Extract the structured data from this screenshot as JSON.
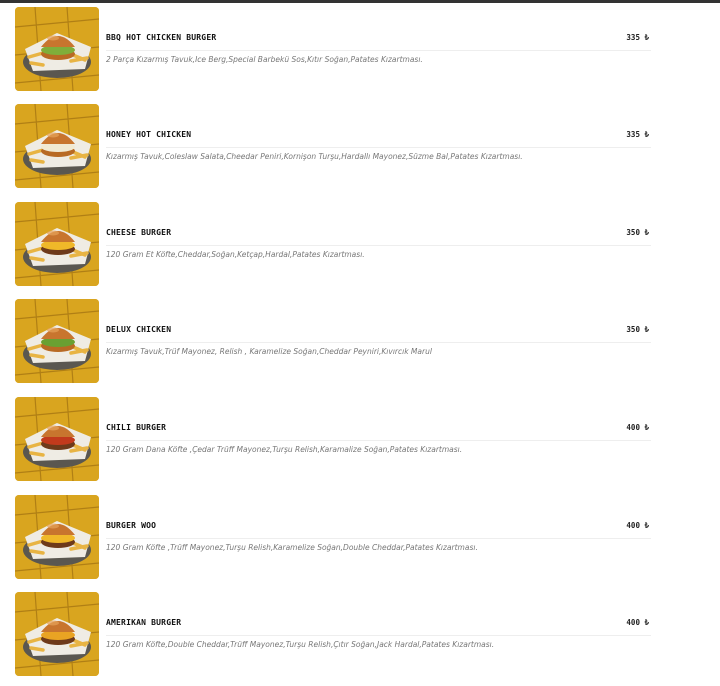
{
  "menu": {
    "currency": "₺",
    "items": [
      {
        "name": "BBQ HOT CHICKEN BURGER",
        "price": "335 ₺",
        "description": "2 Parça Kızarmış Tavuk,Ice Berg,Special Barbekü Sos,Kıtır Soğan,Patates Kızartması."
      },
      {
        "name": "HONEY HOT CHICKEN",
        "price": "335 ₺",
        "description": "Kızarmış Tavuk,Coleslaw Salata,Cheedar Peniri,Kornişon Turşu,Hardallı Mayonez,Süzme Bal,Patates Kızartması."
      },
      {
        "name": "CHEESE BURGER",
        "price": "350 ₺",
        "description": "120 Gram Et Köfte,Cheddar,Soğan,Ketçap,Hardal,Patates Kızartması."
      },
      {
        "name": "DELUX CHICKEN",
        "price": "350 ₺",
        "description": "Kızarmış Tavuk,Trüf Mayonez, Relish , Karamelize Soğan,Cheddar Peyniri,Kıvırcık Marul"
      },
      {
        "name": "CHILI BURGER",
        "price": "400 ₺",
        "description": "120 Gram Dana Köfte ,Çedar Trüff Mayonez,Turşu Relish,Karamalize Soğan,Patates Kızartması."
      },
      {
        "name": "BURGER WOO",
        "price": "400 ₺",
        "description": "120 Gram Köfte ,Trüff Mayonez,Turşu Relish,Karamelize Soğan,Double Cheddar,Patates Kızartması."
      },
      {
        "name": "AMERIKAN BURGER",
        "price": "400 ₺",
        "description": "120 Gram Köfte,Double Cheddar,Trüff Mayonez,Turşu Relish,Çıtır Soğan,Jack Hardal,Patates Kızartması."
      }
    ]
  },
  "colors": {
    "table_yellow": "#d9a51f",
    "tray": "#e8e4dc",
    "bun": "#c8752e",
    "fries": "#e8b443"
  },
  "icons": {
    "item_image": "burger-photo-icon"
  }
}
